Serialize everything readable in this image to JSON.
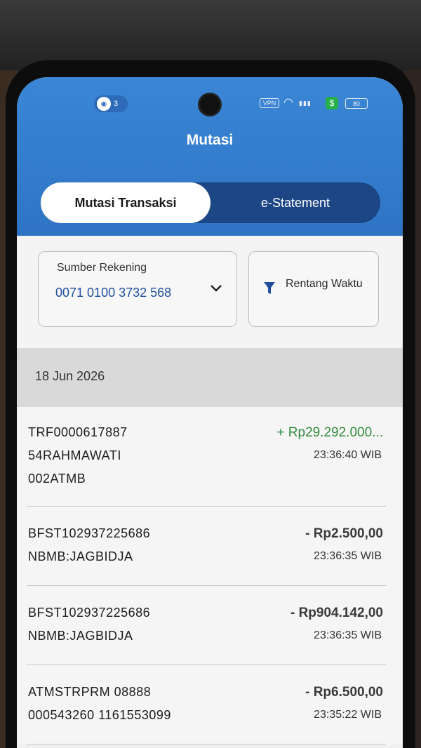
{
  "status_bar": {
    "notification_count": "3",
    "vpn_label": "VPN",
    "battery_label": "80"
  },
  "header": {
    "title": "Mutasi"
  },
  "tabs": [
    {
      "label": "Mutasi Transaksi",
      "active": true
    },
    {
      "label": "e-Statement",
      "active": false
    }
  ],
  "filters": {
    "source_label": "Sumber Rekening",
    "account_number": "0071 0100 3732 568",
    "range_label": "Rentang Waktu"
  },
  "date_group": "18 Jun 2026",
  "transactions": [
    {
      "description": "TRF0000617887 54RAHMAWATI 002ATMB",
      "amount": "+ Rp29.292.000...",
      "time": "23:36:40 WIB",
      "type": "credit"
    },
    {
      "description": "BFST102937225686 NBMB:JAGBIDJA",
      "amount": "- Rp2.500,00",
      "time": "23:36:35 WIB",
      "type": "debit"
    },
    {
      "description": "BFST102937225686 NBMB:JAGBIDJA",
      "amount": "- Rp904.142,00",
      "time": "23:36:35 WIB",
      "type": "debit"
    },
    {
      "description": "ATMSTRPRM 08888 000543260 1161553099",
      "amount": "- Rp6.500,00",
      "time": "23:35:22 WIB",
      "type": "debit"
    }
  ],
  "colors": {
    "header_blue": "#3b86d6",
    "tab_dark": "#1c4684",
    "credit_green": "#2e8b3c",
    "account_blue": "#1f4f9c"
  }
}
